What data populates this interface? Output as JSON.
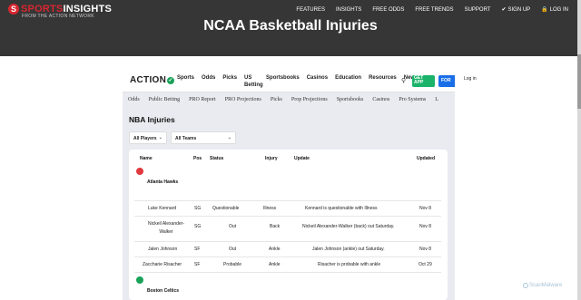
{
  "site": {
    "logo": {
      "main_prefix": "S",
      "main_a": "SPORTS",
      "main_b": "INSIGHTS",
      "sub": "FROM THE ACTION NETWORK"
    },
    "nav": [
      "FEATURES",
      "INSIGHTS",
      "FREE ODDS",
      "FREE TRENDS",
      "SUPPORT"
    ],
    "signup": "SIGN UP",
    "login": "LOG IN",
    "page_title": "NCAA Basketball Injuries"
  },
  "action": {
    "logo": "ACTION",
    "nav": [
      "Sports",
      "Odds",
      "Picks",
      "US Betting",
      "Sportsbooks",
      "Casinos",
      "Education",
      "Resources",
      "News"
    ],
    "get_app": "GET APP",
    "for_label": "FOR",
    "login": "Log in"
  },
  "subnav": [
    "Odds",
    "Public Betting",
    "PRO Report",
    "PRO Projections",
    "Picks",
    "Prop Projections",
    "Sportsbooks",
    "Casinos",
    "Pro Systems",
    "L"
  ],
  "section_title": "NBA Injuries",
  "filters": {
    "players": "All Players",
    "teams": "All Teams"
  },
  "table": {
    "headers": [
      "Name",
      "Pos",
      "Status",
      "Injury",
      "Update",
      "Updated"
    ],
    "teams": [
      {
        "name": "Atlanta Hawks",
        "logo_color": "#e03a3e",
        "players": [
          {
            "name": "Luke Kennard",
            "pos": "SG",
            "status": "Questionable",
            "injury": "Illness",
            "update": "Kennard is questionable with Illness",
            "updated": "Nov 8"
          },
          {
            "name": "Nickeil Alexander-Walker",
            "pos": "SG",
            "status": "Out",
            "injury": "Back",
            "update": "Nickeil Alexander-Walker (back) out Saturday.",
            "updated": "Nov 8"
          },
          {
            "name": "Jalen Johnson",
            "pos": "SF",
            "status": "Out",
            "injury": "Ankle",
            "update": "Jalen Johnson (ankle) out Saturday.",
            "updated": "Nov 8"
          },
          {
            "name": "Zaccharie Risacher",
            "pos": "SF",
            "status": "Probable",
            "injury": "Ankle",
            "update": "Risacher is probable with ankle",
            "updated": "Oct 29"
          }
        ]
      },
      {
        "name": "Boston Celtics",
        "logo_color": "#1aa259",
        "players": []
      }
    ]
  },
  "watermark": "ScanMalware"
}
